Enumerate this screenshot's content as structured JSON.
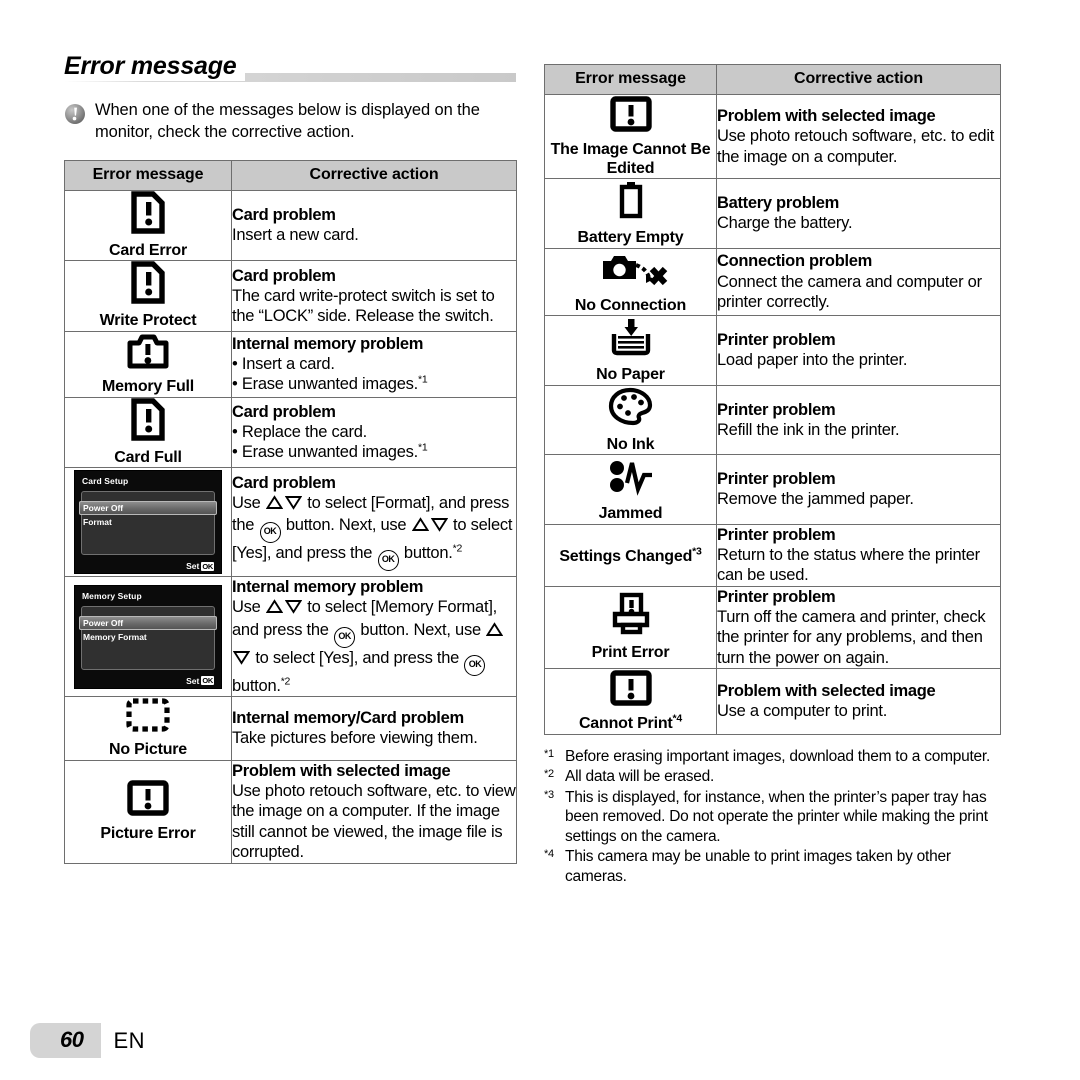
{
  "section": {
    "title": "Error message",
    "note": "When one of the messages below is displayed on the monitor, check the corrective action."
  },
  "table_headers": {
    "message": "Error message",
    "action": "Corrective action"
  },
  "left_table": {
    "rows": [
      {
        "icon": "card-error-icon",
        "label": "Card Error",
        "action_title": "Card problem",
        "action_lines": [
          "Insert a new card."
        ]
      },
      {
        "icon": "card-error-icon",
        "label": "Write Protect",
        "action_title": "Card problem",
        "action_lines": [
          "The card write-protect switch is set to the “LOCK” side. Release the switch."
        ]
      },
      {
        "icon": "memory-full-icon",
        "label": "Memory Full",
        "action_title": "Internal memory problem",
        "bullets": [
          "Insert a card.",
          "Erase unwanted images."
        ],
        "bullet_marks": [
          "",
          "*1"
        ]
      },
      {
        "icon": "card-error-icon",
        "label": "Card Full",
        "action_title": "Card problem",
        "bullets": [
          "Replace the card.",
          "Erase unwanted images."
        ],
        "bullet_marks": [
          "",
          "*1"
        ]
      },
      {
        "icon": "lcd-card-setup",
        "lcd": {
          "title": "Card Setup",
          "selected_row": "Power Off",
          "second_row": "Format",
          "foot_label": "Set",
          "foot_key": "OK"
        },
        "action_title": "Card problem",
        "action_rich": "card_format"
      },
      {
        "icon": "lcd-memory-setup",
        "lcd": {
          "title": "Memory Setup",
          "selected_row": "Power Off",
          "second_row": "Memory Format",
          "foot_label": "Set",
          "foot_key": "OK"
        },
        "action_title": "Internal memory problem",
        "action_rich": "memory_format"
      },
      {
        "icon": "no-picture-icon",
        "label": "No Picture",
        "action_title": "Internal memory/Card problem",
        "action_lines": [
          "Take pictures before viewing them."
        ]
      },
      {
        "icon": "picture-error-icon",
        "label": "Picture Error",
        "action_title": "Problem with selected image",
        "action_lines": [
          "Use photo retouch software, etc. to view the image on a computer. If the image still cannot be viewed, the image file is corrupted."
        ]
      }
    ]
  },
  "right_table": {
    "rows": [
      {
        "icon": "picture-error-icon",
        "label": "The Image Cannot Be Edited",
        "action_title": "Problem with selected image",
        "action_lines": [
          "Use photo retouch software, etc. to edit the image on a computer."
        ]
      },
      {
        "icon": "battery-empty-icon",
        "label": "Battery Empty",
        "action_title": "Battery problem",
        "action_lines": [
          "Charge the battery."
        ]
      },
      {
        "icon": "no-connection-icon",
        "label": "No Connection",
        "action_title": "Connection problem",
        "action_lines": [
          "Connect the camera and computer or printer correctly."
        ]
      },
      {
        "icon": "no-paper-icon",
        "label": "No Paper",
        "action_title": "Printer problem",
        "action_lines": [
          "Load paper into the printer."
        ]
      },
      {
        "icon": "no-ink-icon",
        "label": "No Ink",
        "action_title": "Printer problem",
        "action_lines": [
          "Refill the ink in the printer."
        ]
      },
      {
        "icon": "jammed-icon",
        "label": "Jammed",
        "action_title": "Printer problem",
        "action_lines": [
          "Remove the jammed paper."
        ]
      },
      {
        "icon": "none",
        "label": "Settings Changed",
        "label_mark": "*3",
        "action_title": "Printer problem",
        "action_lines": [
          "Return to the status where the printer can be used."
        ]
      },
      {
        "icon": "print-error-icon",
        "label": "Print Error",
        "action_title": "Printer problem",
        "action_lines": [
          "Turn off the camera and printer, check the printer for any problems, and then turn the power on again."
        ]
      },
      {
        "icon": "picture-error-icon",
        "label": "Cannot Print",
        "label_mark": "*4",
        "action_title": "Problem with selected image",
        "action_lines": [
          "Use a computer to print."
        ]
      }
    ]
  },
  "action_rich": {
    "card_format": {
      "p1": "Use ",
      "p2": " to select [Format], and press the ",
      "p3": " button. Next, use ",
      "p4": " to select [Yes], and press the ",
      "p5": " button.",
      "mark": "*2",
      "ok": "OK"
    },
    "memory_format": {
      "p1": "Use ",
      "p2": " to select [Memory Format], and press the ",
      "p3": " button. Next, use ",
      "p4": " to select [Yes], and press the ",
      "p5": " button.",
      "mark": "*2",
      "ok": "OK"
    }
  },
  "footnotes": [
    {
      "mark": "*1",
      "text": "Before erasing important images, download them to a computer."
    },
    {
      "mark": "*2",
      "text": "All data will be erased."
    },
    {
      "mark": "*3",
      "text": "This is displayed, for instance, when the printer’s paper tray has been removed. Do not operate the printer while making the print settings on the camera."
    },
    {
      "mark": "*4",
      "text": "This camera may be unable to print images taken by other cameras."
    }
  ],
  "footer": {
    "page_number": "60",
    "language": "EN"
  },
  "colors": {
    "header_fill": "#c9c9c9",
    "rule_fill": "#d0d0d0",
    "border": "#6e6e6e",
    "page_badge": "#d4d4d4"
  }
}
